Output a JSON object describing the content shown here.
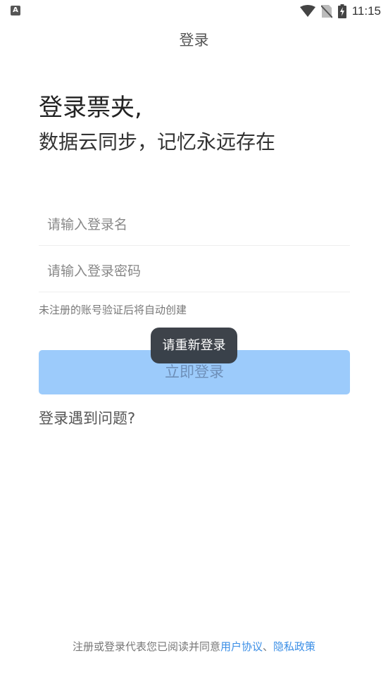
{
  "status_bar": {
    "notification_icon": "A",
    "time": "11:15",
    "icons": [
      "wifi-icon",
      "no-sim-icon",
      "battery-charging-icon"
    ]
  },
  "nav": {
    "title": "登录"
  },
  "headline": {
    "line1": "登录票夹,",
    "line2": "数据云同步，记忆永远存在"
  },
  "form": {
    "username_placeholder": "请输入登录名",
    "password_placeholder": "请输入登录密码",
    "hint": "未注册的账号验证后将自动创建",
    "login_button": "立即登录",
    "login_problem": "登录遇到问题?"
  },
  "toast": {
    "message": "请重新登录"
  },
  "agreement": {
    "prefix": "注册或登录代表您已阅读并同意",
    "user_agreement": "用户协议",
    "separator": "、",
    "privacy_policy": "隐私政策"
  },
  "colors": {
    "button_bg": "#9ccbfb",
    "link": "#3a8ee6",
    "toast_bg": "#343940"
  }
}
